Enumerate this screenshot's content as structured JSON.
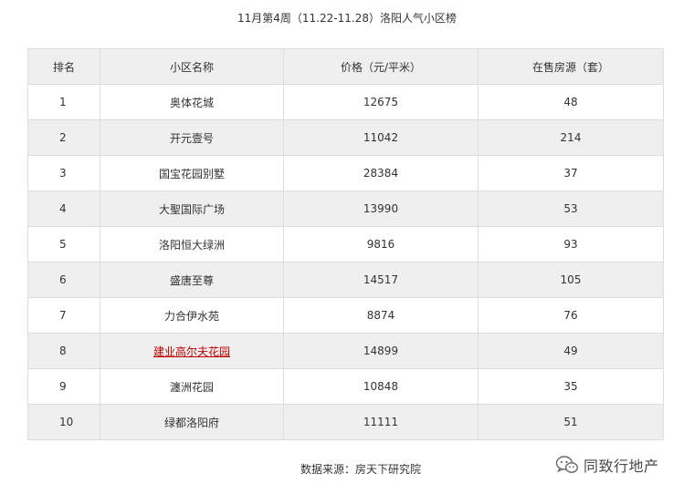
{
  "title": "11月第4周（11.22-11.28）洛阳人气小区榜",
  "table": {
    "headers": [
      "排名",
      "小区名称",
      "价格（元/平米）",
      "在售房源（套）"
    ],
    "rows": [
      {
        "rank": "1",
        "name": "奥体花城",
        "price": "12675",
        "listings": "48"
      },
      {
        "rank": "2",
        "name": "开元壹号",
        "price": "11042",
        "listings": "214"
      },
      {
        "rank": "3",
        "name": "国宝花园别墅",
        "price": "28384",
        "listings": "37"
      },
      {
        "rank": "4",
        "name": "大聖国际广场",
        "price": "13990",
        "listings": "53"
      },
      {
        "rank": "5",
        "name": "洛阳恒大绿洲",
        "price": "9816",
        "listings": "93"
      },
      {
        "rank": "6",
        "name": "盛唐至尊",
        "price": "14517",
        "listings": "105"
      },
      {
        "rank": "7",
        "name": "力合伊水苑",
        "price": "8874",
        "listings": "76"
      },
      {
        "rank": "8",
        "name": "建业高尔夫花园",
        "price": "14899",
        "listings": "49",
        "is_link": true
      },
      {
        "rank": "9",
        "name": "瀍洲花园",
        "price": "10848",
        "listings": "35"
      },
      {
        "rank": "10",
        "name": "绿都洛阳府",
        "price": "11111",
        "listings": "51"
      }
    ]
  },
  "source": "数据来源：房天下研究院",
  "watermark": {
    "text": "同致行地产",
    "icon": "wechat-icon"
  },
  "colors": {
    "header_bg": "#efefef",
    "stripe_bg": "#efefef",
    "border": "#dddddd",
    "link": "#c00000",
    "text": "#333333"
  }
}
